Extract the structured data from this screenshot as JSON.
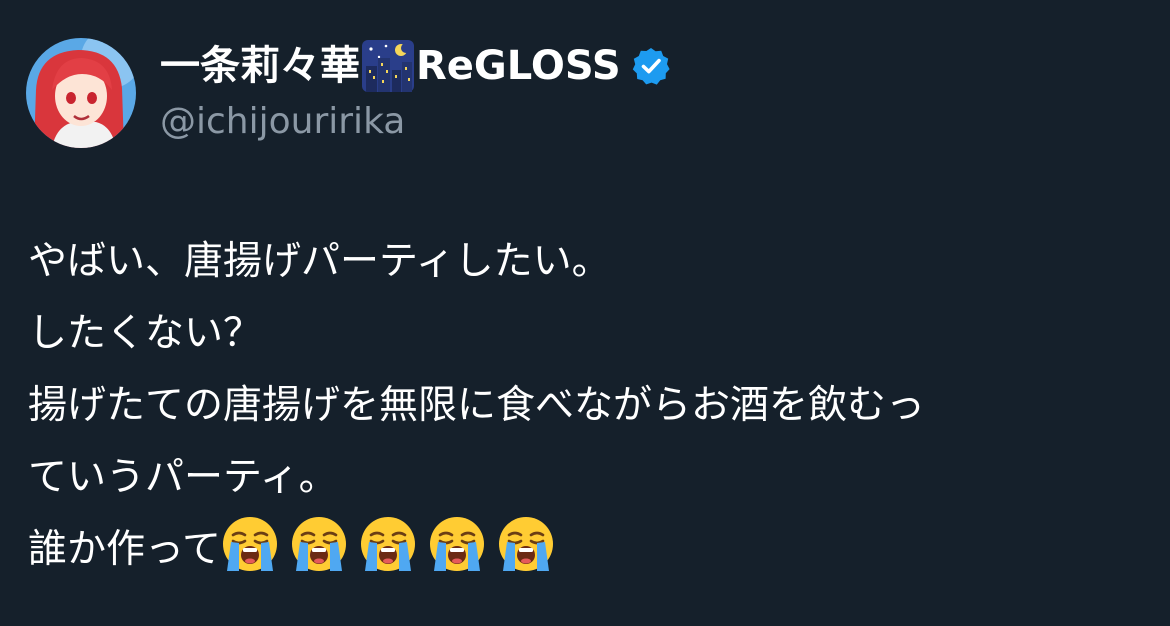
{
  "author": {
    "name_part1": "一条莉々華",
    "name_emoji": "night-with-stars-emoji",
    "name_part2": "ReGLOSS",
    "verified": true,
    "handle": "@ichijouririka",
    "verified_color": "#1d9bf0"
  },
  "tweet": {
    "lines": [
      "やばい、唐揚げパーティしたい。",
      "したくない？",
      "揚げたての唐揚げを無限に食べながらお酒を飲むっ",
      "ていうパーティ。",
      "誰か作って"
    ],
    "trailing_emoji": "loudly-crying-face-emoji",
    "trailing_emoji_count": 5
  },
  "colors": {
    "background": "#15202b",
    "text": "#ffffff",
    "secondary_text": "#8b98a5"
  }
}
